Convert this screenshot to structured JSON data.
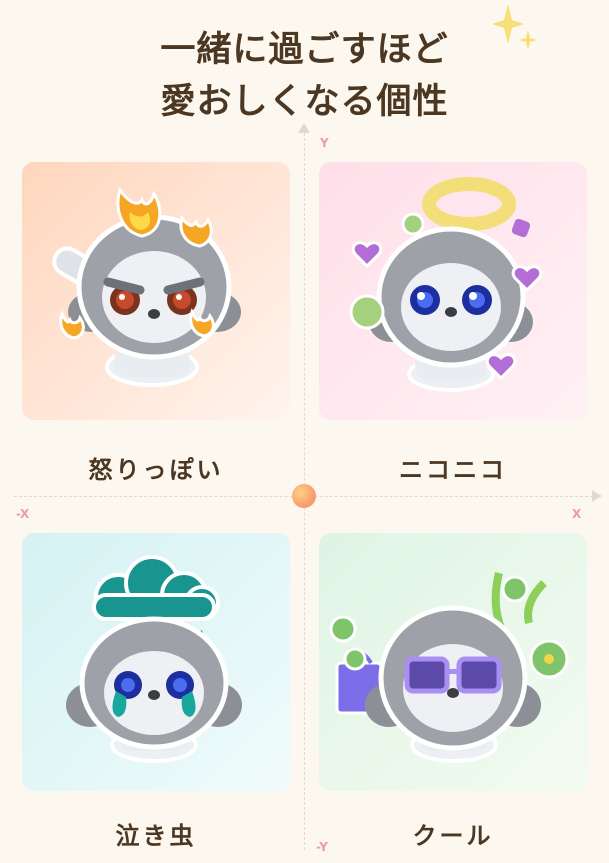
{
  "title_line1": "一緒に過ごすほど",
  "title_line2": "愛おしくなる個性",
  "axis": {
    "y_pos": "Y",
    "y_neg": "-Y",
    "x_pos": "X",
    "x_neg": "-X"
  },
  "quadrants": [
    {
      "label": "怒りっぽい",
      "gradient": [
        "#ffd9c2",
        "#fff3ec"
      ],
      "icon": "angry-robot"
    },
    {
      "label": "ニコニコ",
      "gradient": [
        "#ffe0ea",
        "#fff0f4"
      ],
      "icon": "happy-robot"
    },
    {
      "label": "泣き虫",
      "gradient": [
        "#d7f3f4",
        "#eefbfb"
      ],
      "icon": "crying-robot"
    },
    {
      "label": "クール",
      "gradient": [
        "#dff4e4",
        "#f3fbf1"
      ],
      "icon": "cool-robot"
    }
  ],
  "colors": {
    "accent": "#f6a06b",
    "text": "#4b3722",
    "axis_label": "#ee9aa4"
  }
}
